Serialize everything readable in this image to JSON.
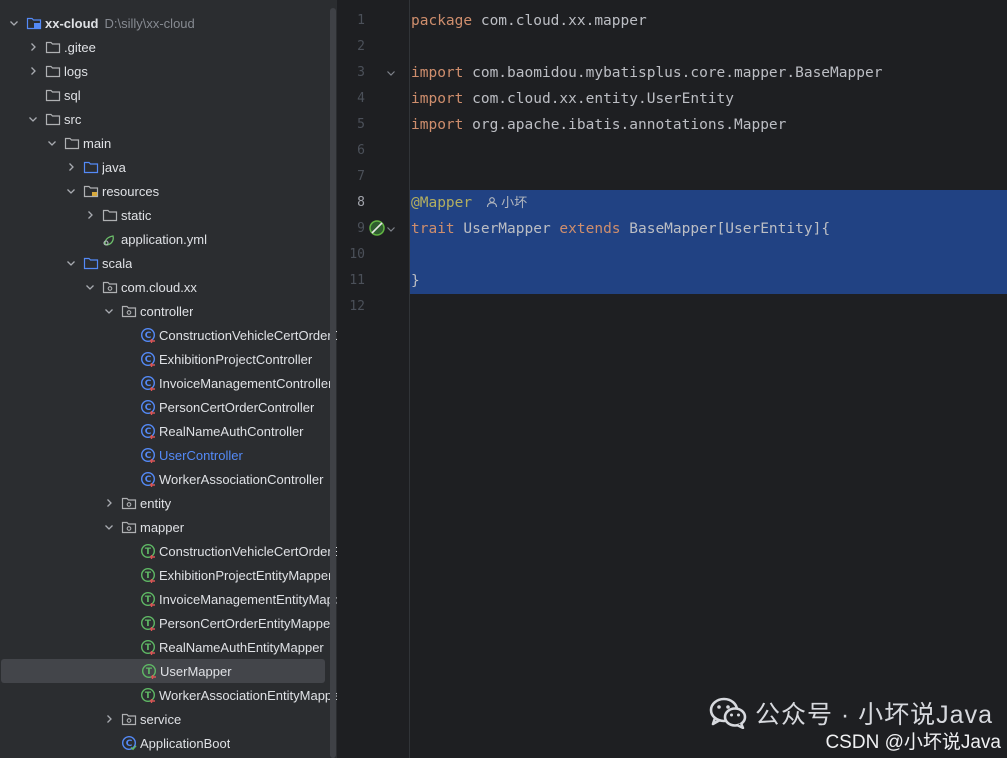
{
  "project": {
    "root": {
      "name": "xx-cloud",
      "path": "D:\\silly\\xx-cloud"
    },
    "tree": [
      {
        "label": "xx-cloud",
        "depth": 0,
        "chevron": "down",
        "icon": "module",
        "root": true
      },
      {
        "label": ".gitee",
        "depth": 1,
        "chevron": "right",
        "icon": "folder"
      },
      {
        "label": "logs",
        "depth": 1,
        "chevron": "right",
        "icon": "folder"
      },
      {
        "label": "sql",
        "depth": 1,
        "chevron": "none",
        "icon": "folder"
      },
      {
        "label": "src",
        "depth": 1,
        "chevron": "down",
        "icon": "folder"
      },
      {
        "label": "main",
        "depth": 2,
        "chevron": "down",
        "icon": "folder"
      },
      {
        "label": "java",
        "depth": 3,
        "chevron": "right",
        "icon": "source-folder"
      },
      {
        "label": "resources",
        "depth": 3,
        "chevron": "down",
        "icon": "resources-folder"
      },
      {
        "label": "static",
        "depth": 4,
        "chevron": "right",
        "icon": "folder"
      },
      {
        "label": "application.yml",
        "depth": 4,
        "chevron": "none",
        "icon": "yaml"
      },
      {
        "label": "scala",
        "depth": 3,
        "chevron": "down",
        "icon": "source-folder"
      },
      {
        "label": "com.cloud.xx",
        "depth": 4,
        "chevron": "down",
        "icon": "package"
      },
      {
        "label": "controller",
        "depth": 5,
        "chevron": "down",
        "icon": "package"
      },
      {
        "label": "ConstructionVehicleCertOrderCo",
        "depth": 6,
        "chevron": "none",
        "icon": "class"
      },
      {
        "label": "ExhibitionProjectController",
        "depth": 6,
        "chevron": "none",
        "icon": "class"
      },
      {
        "label": "InvoiceManagementController",
        "depth": 6,
        "chevron": "none",
        "icon": "class"
      },
      {
        "label": "PersonCertOrderController",
        "depth": 6,
        "chevron": "none",
        "icon": "class"
      },
      {
        "label": "RealNameAuthController",
        "depth": 6,
        "chevron": "none",
        "icon": "class"
      },
      {
        "label": "UserController",
        "depth": 6,
        "chevron": "none",
        "icon": "class",
        "highlight": true
      },
      {
        "label": "WorkerAssociationController",
        "depth": 6,
        "chevron": "none",
        "icon": "class"
      },
      {
        "label": "entity",
        "depth": 5,
        "chevron": "right",
        "icon": "package"
      },
      {
        "label": "mapper",
        "depth": 5,
        "chevron": "down",
        "icon": "package"
      },
      {
        "label": "ConstructionVehicleCertOrderEn",
        "depth": 6,
        "chevron": "none",
        "icon": "trait"
      },
      {
        "label": "ExhibitionProjectEntityMapper",
        "depth": 6,
        "chevron": "none",
        "icon": "trait"
      },
      {
        "label": "InvoiceManagementEntityMapp",
        "depth": 6,
        "chevron": "none",
        "icon": "trait"
      },
      {
        "label": "PersonCertOrderEntityMapper",
        "depth": 6,
        "chevron": "none",
        "icon": "trait"
      },
      {
        "label": "RealNameAuthEntityMapper",
        "depth": 6,
        "chevron": "none",
        "icon": "trait"
      },
      {
        "label": "UserMapper",
        "depth": 6,
        "chevron": "none",
        "icon": "trait",
        "selected": true
      },
      {
        "label": "WorkerAssociationEntityMappe",
        "depth": 6,
        "chevron": "none",
        "icon": "trait"
      },
      {
        "label": "service",
        "depth": 5,
        "chevron": "right",
        "icon": "package"
      },
      {
        "label": "ApplicationBoot",
        "depth": 5,
        "chevron": "none",
        "icon": "class-main"
      }
    ]
  },
  "editor": {
    "current_line": 8,
    "selected_lines": [
      8,
      9,
      10,
      11
    ],
    "lines": [
      {
        "n": "1",
        "tokens": [
          {
            "t": "package",
            "c": "kw"
          },
          {
            "t": " com.cloud.xx.mapper"
          }
        ]
      },
      {
        "n": "2",
        "tokens": []
      },
      {
        "n": "3",
        "fold": true,
        "tokens": [
          {
            "t": "import",
            "c": "kw"
          },
          {
            "t": " com.baomidou.mybatisplus.core.mapper.BaseMapper"
          }
        ]
      },
      {
        "n": "4",
        "tokens": [
          {
            "t": "import",
            "c": "kw"
          },
          {
            "t": " com.cloud.xx.entity.UserEntity"
          }
        ]
      },
      {
        "n": "5",
        "tokens": [
          {
            "t": "import",
            "c": "kw"
          },
          {
            "t": " org.apache.ibatis.annotations.Mapper"
          }
        ]
      },
      {
        "n": "6",
        "tokens": []
      },
      {
        "n": "7",
        "tokens": []
      },
      {
        "n": "8",
        "tokens": [
          {
            "t": "@Mapper",
            "c": "ann"
          }
        ],
        "author": "小坏"
      },
      {
        "n": "9",
        "fold": true,
        "gutter_icon": true,
        "tokens": [
          {
            "t": "trait",
            "c": "kw"
          },
          {
            "t": " UserMapper "
          },
          {
            "t": "extends",
            "c": "kw"
          },
          {
            "t": " BaseMapper[UserEntity]{"
          }
        ]
      },
      {
        "n": "10",
        "tokens": []
      },
      {
        "n": "11",
        "tokens": [
          {
            "t": "}"
          }
        ]
      },
      {
        "n": "12",
        "tokens": []
      }
    ]
  },
  "watermark": {
    "text": "公众号 · 小坏说Java",
    "csdn": "CSDN @小坏说Java"
  },
  "colors": {
    "keyword": "#cf8e6d",
    "annotation": "#b3ae60",
    "selection": "#214283",
    "folder": "#afb1b3",
    "source_folder": "#548af7",
    "trait_green": "#5fb865"
  }
}
